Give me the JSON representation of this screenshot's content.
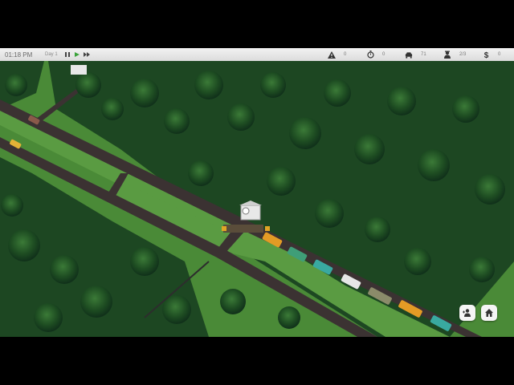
{
  "hud": {
    "time": "01:18 PM",
    "day": "Day 1",
    "stats": {
      "warnings": "0",
      "timer": "0",
      "cars": "71",
      "workers": "2/3",
      "money": "0"
    }
  },
  "icons": {
    "pause": "pause-icon",
    "play": "play-icon",
    "fast_forward": "fast-forward-icon",
    "warning": "warning-icon",
    "stopwatch": "stopwatch-icon",
    "car": "car-icon",
    "worker": "worker-icon",
    "money": "dollar-icon",
    "add_worker": "add-worker-icon",
    "home": "home-icon"
  },
  "colors": {
    "hud_bg": "#e6e6e6",
    "play_accent": "#3aa23a",
    "grass": "#4f8f3a",
    "forest": "#1f4e22",
    "road": "#3b3232"
  }
}
